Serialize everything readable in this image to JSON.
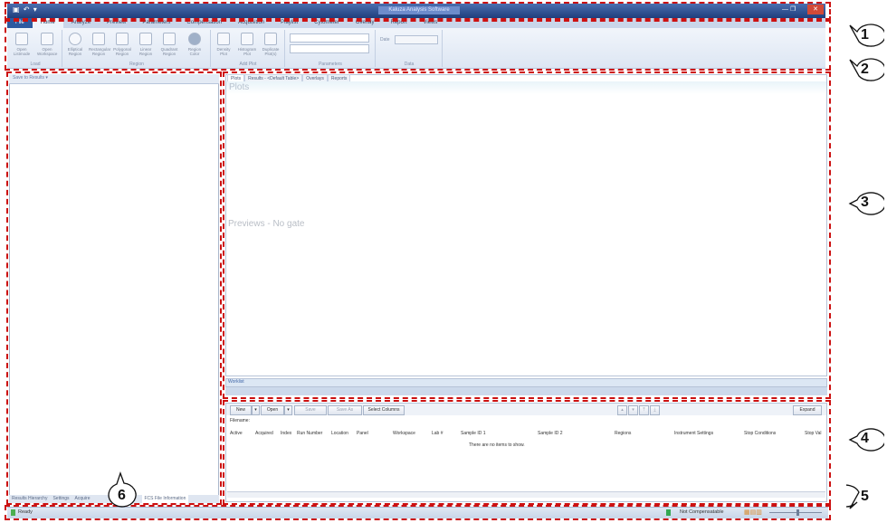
{
  "app": {
    "quick_access": "▣ ↶ ▾",
    "title": "Kaluza Analysis Software"
  },
  "window_controls": {
    "minmax": "— ❐",
    "close": "✕"
  },
  "ribbon": {
    "tabs": [
      "File",
      "Home",
      "Analyze",
      "Preview",
      "Parameters",
      "Compensation",
      "Acquisition",
      "Playlist",
      "Cytometer",
      "Overlay",
      "Report",
      "Views"
    ],
    "groups": {
      "load": {
        "label": "Load",
        "buttons": [
          "Open Listmode",
          "Open Workspace"
        ]
      },
      "region": {
        "label": "Region",
        "buttons": [
          "Elliptical Region",
          "Rectangular Region",
          "Polygonal Region",
          "Linear Region",
          "Quadrant Region",
          "Region Color"
        ]
      },
      "add_plot": {
        "label": "Add Plot",
        "buttons": [
          "Density Plot",
          "Histogram Plot",
          "Duplicate Plot(s)"
        ]
      },
      "parameters": {
        "label": "Parameters"
      },
      "data": {
        "label": "Data",
        "date_label": "Date"
      }
    }
  },
  "left_panel": {
    "save_button": "Save to Results ▾",
    "tabs": [
      "Results Hierarchy",
      "Settings",
      "Acquire",
      "",
      "FCS File Information"
    ]
  },
  "plots": {
    "tabs": [
      "Plots",
      "Results - <Default Table>",
      "Overlays",
      "Reports"
    ],
    "title": "Plots",
    "empty_text": "Previews - No gate"
  },
  "worklist": {
    "label": "Worklist",
    "buttons": {
      "new": "New",
      "open": "Open",
      "save": "Save",
      "save_as": "Save As",
      "select_columns": "Select Columns",
      "expand": "Expand"
    },
    "filename_label": "Filename:",
    "columns": [
      "Active",
      "Acquired",
      "Index",
      "Run Number",
      "Location",
      "Panel",
      "Workspace",
      "Lab #",
      "Sample ID 1",
      "Sample ID 2",
      "Regions",
      "Instrument Settings",
      "Stop Conditions",
      "Stop Val"
    ],
    "empty_message": "There are no items to show."
  },
  "status_bar": {
    "status": "Ready",
    "compensation": "Not Compensatable"
  },
  "callouts": [
    "1",
    "2",
    "3",
    "4",
    "5",
    "6"
  ],
  "colors": {
    "annotation": "#cc1111",
    "ribbon_file": "#2d5aa0",
    "title_bar": "#1f3e7c"
  }
}
